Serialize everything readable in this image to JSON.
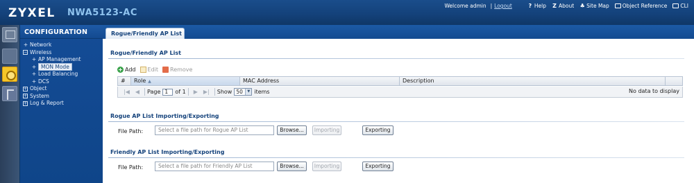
{
  "header": {
    "brand": "ZYXEL",
    "model": "NWA5123-AC",
    "welcome": "Welcome admin",
    "separator": "|",
    "logout": "Logout",
    "links": [
      {
        "label": "Help",
        "icon": "help-icon",
        "glyph": "?"
      },
      {
        "label": "About",
        "icon": "about-icon",
        "glyph": "Z"
      },
      {
        "label": "Site Map",
        "icon": "site-map-icon",
        "glyph": "♣"
      },
      {
        "label": "Object Reference",
        "icon": "object-reference-icon",
        "glyph": ""
      },
      {
        "label": "CLI",
        "icon": "cli-icon",
        "glyph": ""
      }
    ]
  },
  "nav": {
    "title": "CONFIGURATION",
    "items": [
      {
        "label": "Network",
        "level": 1,
        "marker": "+"
      },
      {
        "label": "Wireless",
        "level": 1,
        "marker": "−"
      },
      {
        "label": "AP Management",
        "level": 2,
        "marker": "+"
      },
      {
        "label": "MON Mode",
        "level": 2,
        "marker": "+",
        "selected": true
      },
      {
        "label": "Load Balancing",
        "level": 2,
        "marker": "+"
      },
      {
        "label": "DCS",
        "level": 2,
        "marker": "+"
      },
      {
        "label": "Object",
        "level": 1,
        "marker": "+"
      },
      {
        "label": "System",
        "level": 1,
        "marker": "+"
      },
      {
        "label": "Log & Report",
        "level": 1,
        "marker": "+"
      }
    ]
  },
  "main": {
    "tab": "Rogue/Friendly AP List",
    "list_section": {
      "title": "Rogue/Friendly AP List",
      "toolbar": {
        "add": "Add",
        "edit": "Edit",
        "remove": "Remove"
      },
      "columns": [
        "#",
        "Role",
        "MAC Address",
        "Description"
      ],
      "sorted_column": "Role",
      "pager": {
        "page_label": "Page",
        "page_value": "1",
        "of_label": "of 1",
        "show_label": "Show",
        "show_value": "50",
        "items_label": "items",
        "no_data": "No data to display"
      }
    },
    "rogue_section": {
      "title": "Rogue AP List Importing/Exporting",
      "file_label": "File Path:",
      "placeholder": "Select a file path for Rogue AP List",
      "browse": "Browse...",
      "importing": "Importing",
      "exporting": "Exporting"
    },
    "friendly_section": {
      "title": "Friendly AP List Importing/Exporting",
      "file_label": "File Path:",
      "placeholder": "Select a file path for Friendly AP List",
      "browse": "Browse...",
      "importing": "Importing",
      "exporting": "Exporting"
    }
  },
  "colors": {
    "header_bg": "#14427b",
    "nav_bg": "#0f4589",
    "accent_text": "#14427b"
  }
}
